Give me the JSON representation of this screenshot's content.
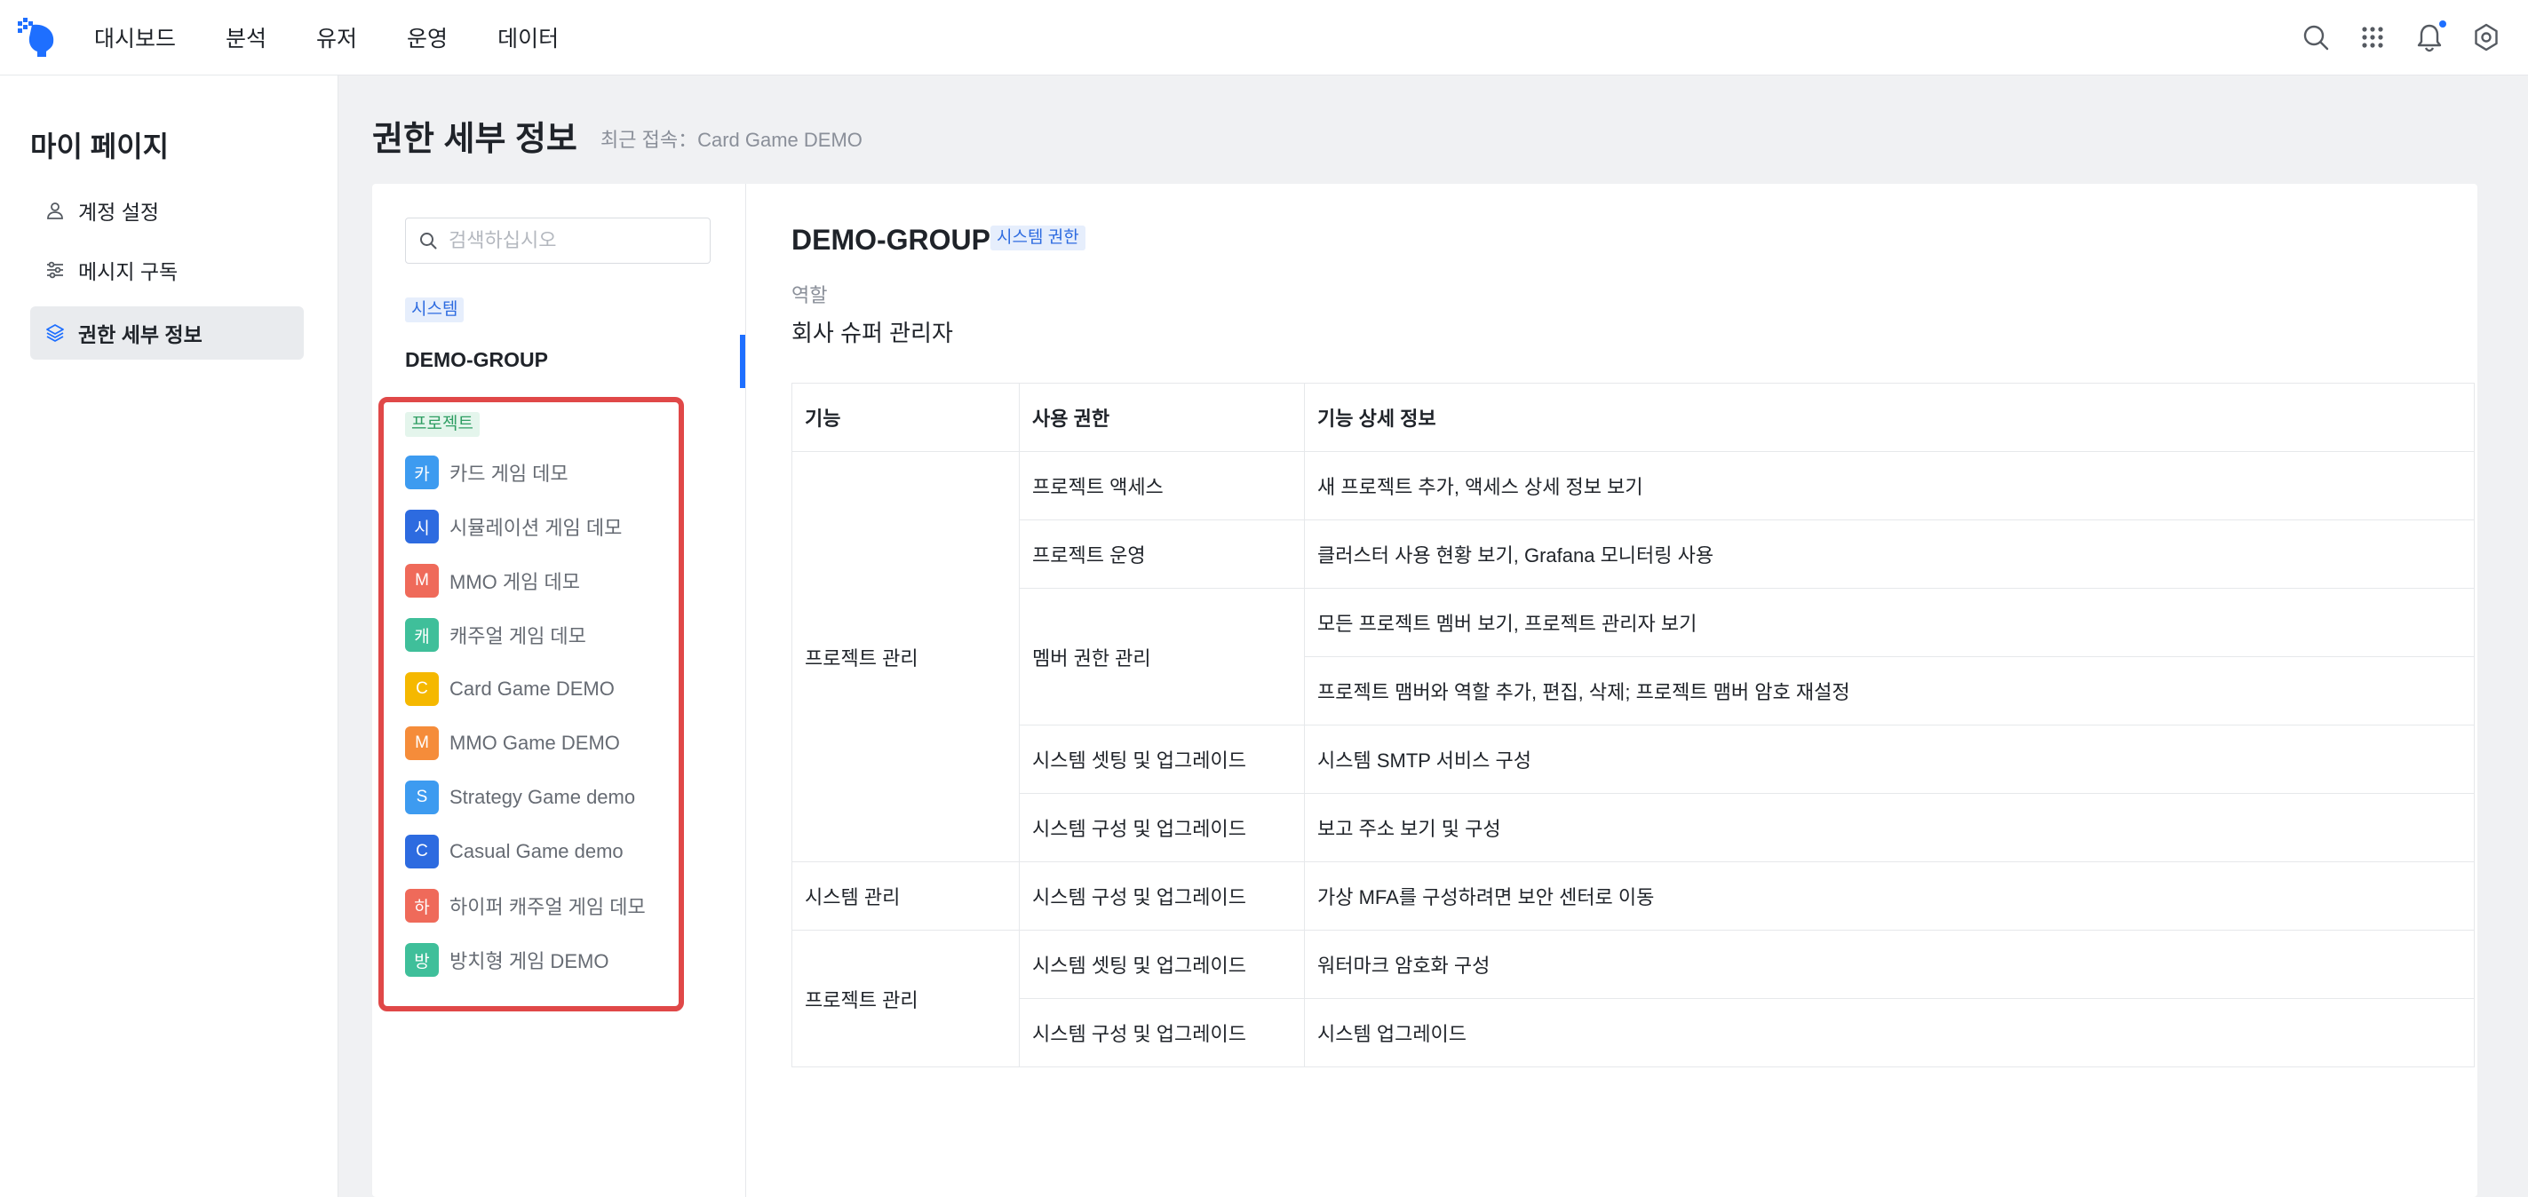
{
  "nav": {
    "items": [
      "대시보드",
      "분석",
      "유저",
      "운영",
      "데이터"
    ]
  },
  "top_icons": [
    "search-icon",
    "apps-grid-icon",
    "bell-icon",
    "settings-icon"
  ],
  "sidebar": {
    "title": "마이 페이지",
    "items": [
      {
        "label": "계정 설정",
        "icon": "user-icon",
        "active": false
      },
      {
        "label": "메시지 구독",
        "icon": "sliders-icon",
        "active": false
      },
      {
        "label": "권한 세부 정보",
        "icon": "layers-icon",
        "active": true
      }
    ]
  },
  "header": {
    "title": "권한 세부 정보",
    "subtitle": "최근 접속：Card Game DEMO"
  },
  "list": {
    "search_placeholder": "검색하십시오",
    "system_tag": "시스템",
    "group": "DEMO-GROUP",
    "project_tag": "프로젝트",
    "projects": [
      {
        "badge": "카",
        "label": "카드 게임 데모",
        "color": "#3d9bf0"
      },
      {
        "badge": "시",
        "label": "시뮬레이션 게임 데모",
        "color": "#2d6be0"
      },
      {
        "badge": "M",
        "label": "MMO 게임 데모",
        "color": "#ef6a5a"
      },
      {
        "badge": "캐",
        "label": "캐주얼 게임 데모",
        "color": "#3fbf9a"
      },
      {
        "badge": "C",
        "label": "Card Game DEMO",
        "color": "#f5b800"
      },
      {
        "badge": "M",
        "label": "MMO Game DEMO",
        "color": "#f58c3a"
      },
      {
        "badge": "S",
        "label": "Strategy Game demo",
        "color": "#3d9bf0"
      },
      {
        "badge": "C",
        "label": "Casual Game demo",
        "color": "#2d6be0"
      },
      {
        "badge": "하",
        "label": "하이퍼 캐주얼 게임 데모",
        "color": "#ef6a5a"
      },
      {
        "badge": "방",
        "label": "방치형 게임 DEMO",
        "color": "#3fbf9a"
      }
    ]
  },
  "detail": {
    "title": "DEMO-GROUP",
    "tag": "시스템 권한",
    "role_label": "역할",
    "role_value": "회사 슈퍼 관리자",
    "table": {
      "headers": [
        "기능",
        "사용 권한",
        "기능 상세 정보"
      ],
      "rows": [
        {
          "feature": "프로젝트 관리",
          "permission": "프로젝트 액세스",
          "detail": "새 프로젝트 추가, 액세스 상세 정보 보기"
        },
        {
          "feature": "",
          "permission": "프로젝트 운영",
          "detail": "클러스터 사용 현황 보기, Grafana 모니터링 사용"
        },
        {
          "feature": "",
          "permission": "멤버 권한 관리",
          "detail": "모든 프로젝트 멤버 보기, 프로젝트 관리자 보기"
        },
        {
          "feature": "",
          "permission": "",
          "detail": "프로젝트 맴버와 역할 추가, 편집, 삭제; 프로젝트 맴버 암호 재설정"
        },
        {
          "feature": "",
          "permission": "시스템 셋팅 및 업그레이드",
          "detail": "시스템 SMTP 서비스 구성"
        },
        {
          "feature": "",
          "permission": "시스템 구성 및 업그레이드",
          "detail": "보고 주소 보기 및 구성"
        },
        {
          "feature": "시스템 관리",
          "permission": "시스템 구성 및 업그레이드",
          "detail": "가상 MFA를 구성하려면 보안 센터로 이동"
        },
        {
          "feature": "프로젝트 관리",
          "permission": "시스템 셋팅 및 업그레이드",
          "detail": "워터마크 암호화 구성"
        },
        {
          "feature": "",
          "permission": "시스템 구성 및 업그레이드",
          "detail": "시스템 업그레이드"
        }
      ]
    }
  },
  "colors": {
    "accent": "#1e6fff",
    "highlight_border": "#e04848"
  }
}
